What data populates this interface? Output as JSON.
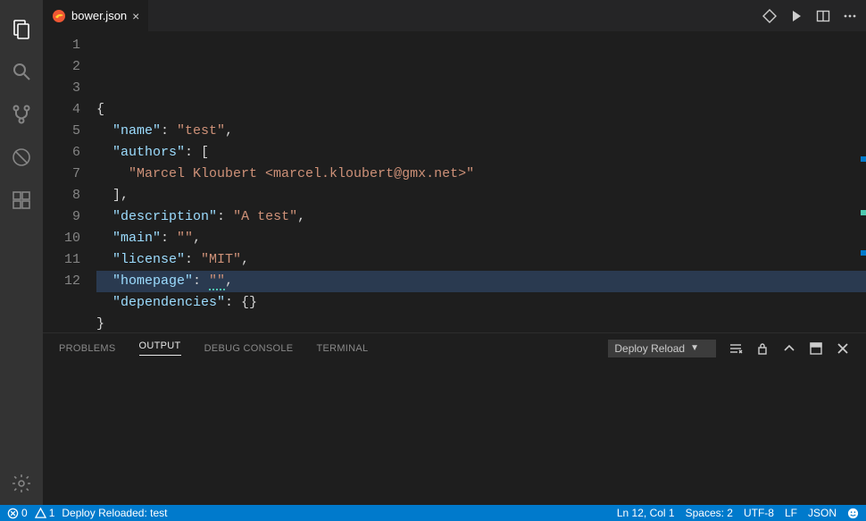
{
  "tab": {
    "filename": "bower.json"
  },
  "editor": {
    "lines": [
      {
        "n": 1,
        "indent": 0,
        "raw": "{"
      },
      {
        "n": 2,
        "indent": 1,
        "key": "name",
        "val": "test",
        "comma": true
      },
      {
        "n": 3,
        "indent": 1,
        "key": "authors",
        "after": ": ["
      },
      {
        "n": 4,
        "indent": 2,
        "str": "Marcel Kloubert <marcel.kloubert@gmx.net>"
      },
      {
        "n": 5,
        "indent": 1,
        "raw": "],"
      },
      {
        "n": 6,
        "indent": 1,
        "key": "description",
        "val": "A test",
        "comma": true
      },
      {
        "n": 7,
        "indent": 1,
        "key": "main",
        "val": "",
        "comma": true
      },
      {
        "n": 8,
        "indent": 1,
        "key": "license",
        "val": "MIT",
        "comma": true
      },
      {
        "n": 9,
        "indent": 1,
        "key": "homepage",
        "val": "",
        "comma": true,
        "squiggle": true
      },
      {
        "n": 10,
        "indent": 1,
        "key": "dependencies",
        "after": ": {}"
      },
      {
        "n": 11,
        "indent": 0,
        "raw": "}"
      },
      {
        "n": 12,
        "indent": 0,
        "raw": ""
      }
    ],
    "current_line_index": 11
  },
  "panel": {
    "tabs": {
      "problems": "PROBLEMS",
      "output": "OUTPUT",
      "debug": "DEBUG CONSOLE",
      "terminal": "TERMINAL"
    },
    "select_label": "Deploy Reload"
  },
  "status": {
    "errors": "0",
    "warnings": "1",
    "task": "Deploy Reloaded: test",
    "ln_col": "Ln 12, Col 1",
    "spaces": "Spaces: 2",
    "encoding": "UTF-8",
    "eol": "LF",
    "language": "JSON"
  }
}
